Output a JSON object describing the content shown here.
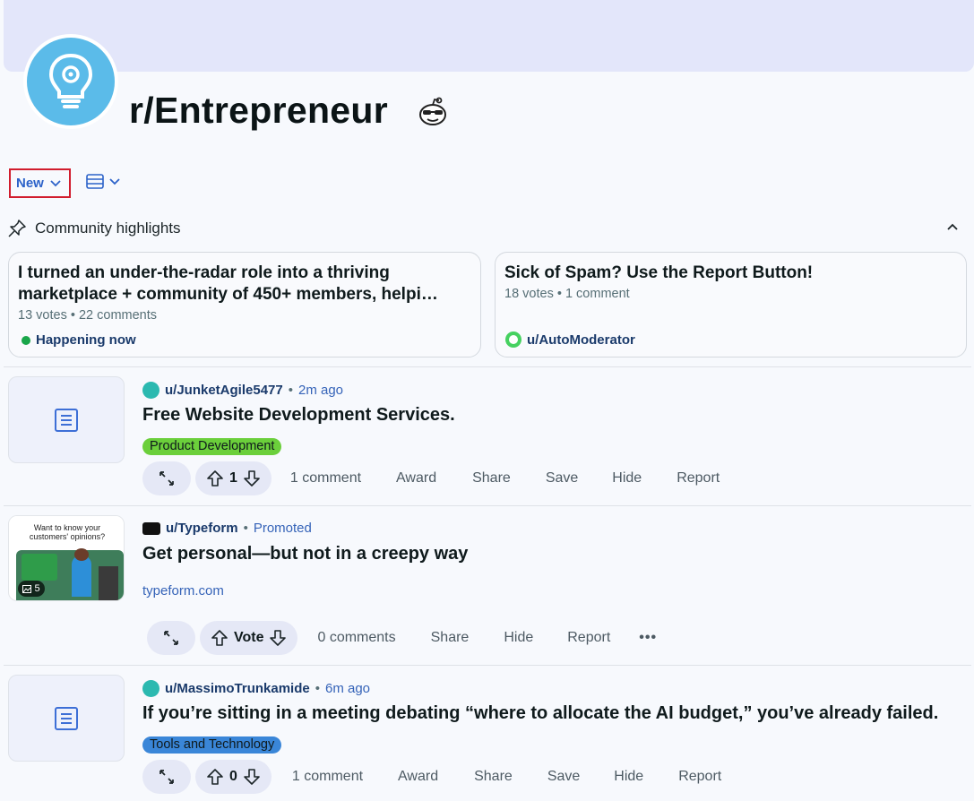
{
  "subreddit": {
    "name": "r/Entrepreneur"
  },
  "toolbar": {
    "sort_label": "New"
  },
  "highlights": {
    "header": "Community highlights",
    "cards": [
      {
        "title": "I turned an under-the-radar role into a thriving marketplace + community of 450+ members, helpi…",
        "votes": "13 votes",
        "comments": "22 comments",
        "footer": "Happening now"
      },
      {
        "title": "Sick of Spam? Use the Report Button!",
        "votes": "18 votes",
        "comments": "1 comment",
        "footer": "u/AutoModerator"
      }
    ]
  },
  "posts": [
    {
      "author": "u/JunketAgile5477",
      "time": "2m ago",
      "title": "Free Website Development Services.",
      "flair": "Product Development",
      "flair_color": "#6bcf3b",
      "score": "1",
      "comments": "1 comment",
      "award": "Award",
      "share": "Share",
      "save": "Save",
      "hide": "Hide",
      "report": "Report"
    },
    {
      "author": "u/Typeform",
      "time": "Promoted",
      "title": "Get personal—but not in a creepy way",
      "domain": "typeform.com",
      "score": "Vote",
      "comments": "0 comments",
      "share": "Share",
      "hide": "Hide",
      "report": "Report",
      "thumb_text": "Want to know your customers' opinions?",
      "thumb_count": "5"
    },
    {
      "author": "u/MassimoTrunkamide",
      "time": "6m ago",
      "title": "If you’re sitting in a meeting debating “where to allocate the AI budget,” you’ve already failed.",
      "flair": "Tools and Technology",
      "flair_color": "#3a86d8",
      "score": "0",
      "comments": "1 comment",
      "award": "Award",
      "share": "Share",
      "save": "Save",
      "hide": "Hide",
      "report": "Report"
    }
  ],
  "colors": {
    "accent": "#2c62c9",
    "banner": "#e3e6fa",
    "pill": "#e5e8f6"
  }
}
